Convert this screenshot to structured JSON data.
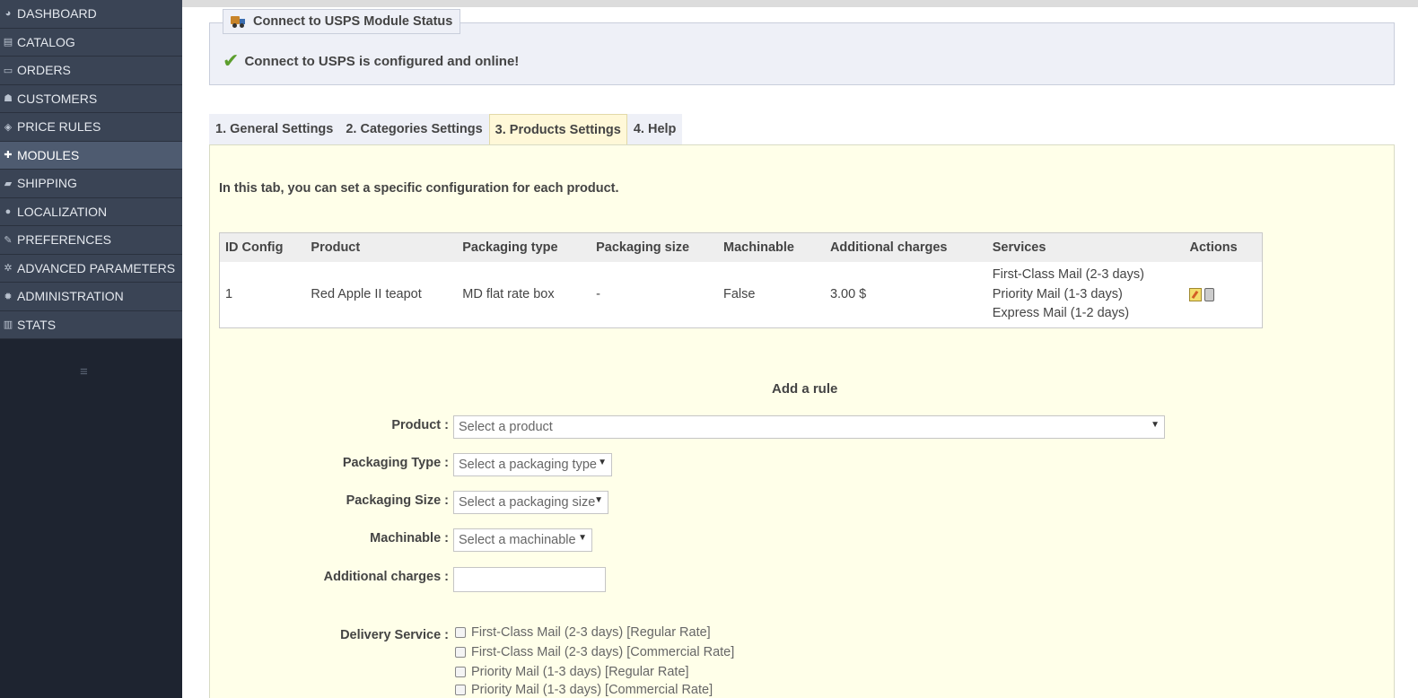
{
  "sidebar": {
    "items": [
      {
        "label": "DASHBOARD",
        "icon": "dashboard-icon"
      },
      {
        "label": "CATALOG",
        "icon": "book-icon"
      },
      {
        "label": "ORDERS",
        "icon": "credit-card-icon"
      },
      {
        "label": "CUSTOMERS",
        "icon": "users-icon"
      },
      {
        "label": "PRICE RULES",
        "icon": "tags-icon"
      },
      {
        "label": "MODULES",
        "icon": "puzzle-icon"
      },
      {
        "label": "SHIPPING",
        "icon": "truck-icon"
      },
      {
        "label": "LOCALIZATION",
        "icon": "globe-icon"
      },
      {
        "label": "PREFERENCES",
        "icon": "wrench-icon"
      },
      {
        "label": "ADVANCED PARAMETERS",
        "icon": "cogs-icon"
      },
      {
        "label": "ADMINISTRATION",
        "icon": "cog-icon"
      },
      {
        "label": "STATS",
        "icon": "bar-chart-icon"
      }
    ],
    "active_item": "MODULES"
  },
  "status": {
    "legend": "Connect to USPS Module Status",
    "message": "Connect to USPS is configured and online!"
  },
  "tabs": [
    {
      "label": "1. General Settings"
    },
    {
      "label": "2. Categories Settings"
    },
    {
      "label": "3. Products Settings"
    },
    {
      "label": "4. Help"
    }
  ],
  "active_tab": "3. Products Settings",
  "intro": "In this tab, you can set a specific configuration for each product.",
  "table": {
    "headers": [
      "ID Config",
      "Product",
      "Packaging type",
      "Packaging size",
      "Machinable",
      "Additional charges",
      "Services",
      "Actions"
    ],
    "rows": [
      {
        "id": "1",
        "product": "Red Apple II teapot",
        "packaging_type": "MD flat rate box",
        "packaging_size": "-",
        "machinable": "False",
        "additional_charges": "3.00 $",
        "services": [
          "First-Class Mail (2-3 days)",
          "Priority Mail (1-3 days)",
          "Express Mail (1-2 days)"
        ]
      }
    ]
  },
  "form": {
    "title": "Add a rule",
    "product_label": "Product :",
    "product_placeholder": "Select a product",
    "packaging_type_label": "Packaging Type :",
    "packaging_type_placeholder": "Select a packaging type",
    "packaging_size_label": "Packaging Size :",
    "packaging_size_placeholder": "Select a packaging size",
    "machinable_label": "Machinable :",
    "machinable_placeholder": "Select a machinable",
    "additional_charges_label": "Additional charges :",
    "additional_charges_value": "",
    "delivery_service_label": "Delivery Service :",
    "delivery_services": [
      "First-Class Mail (2-3 days) [Regular Rate]",
      "First-Class Mail (2-3 days) [Commercial Rate]",
      "Priority Mail (1-3 days) [Regular Rate]",
      "Priority Mail (1-3 days) [Commercial Rate]"
    ]
  },
  "colors": {
    "sidebar_bg": "#1e2430",
    "nav_item_bg": "#3a4455",
    "nav_active_bg": "#4e5b70",
    "panel_bg": "#ffffe9",
    "status_bg": "#eef0f7",
    "active_tab_bg": "#fff8d8",
    "check_green": "#5c9e2e"
  }
}
